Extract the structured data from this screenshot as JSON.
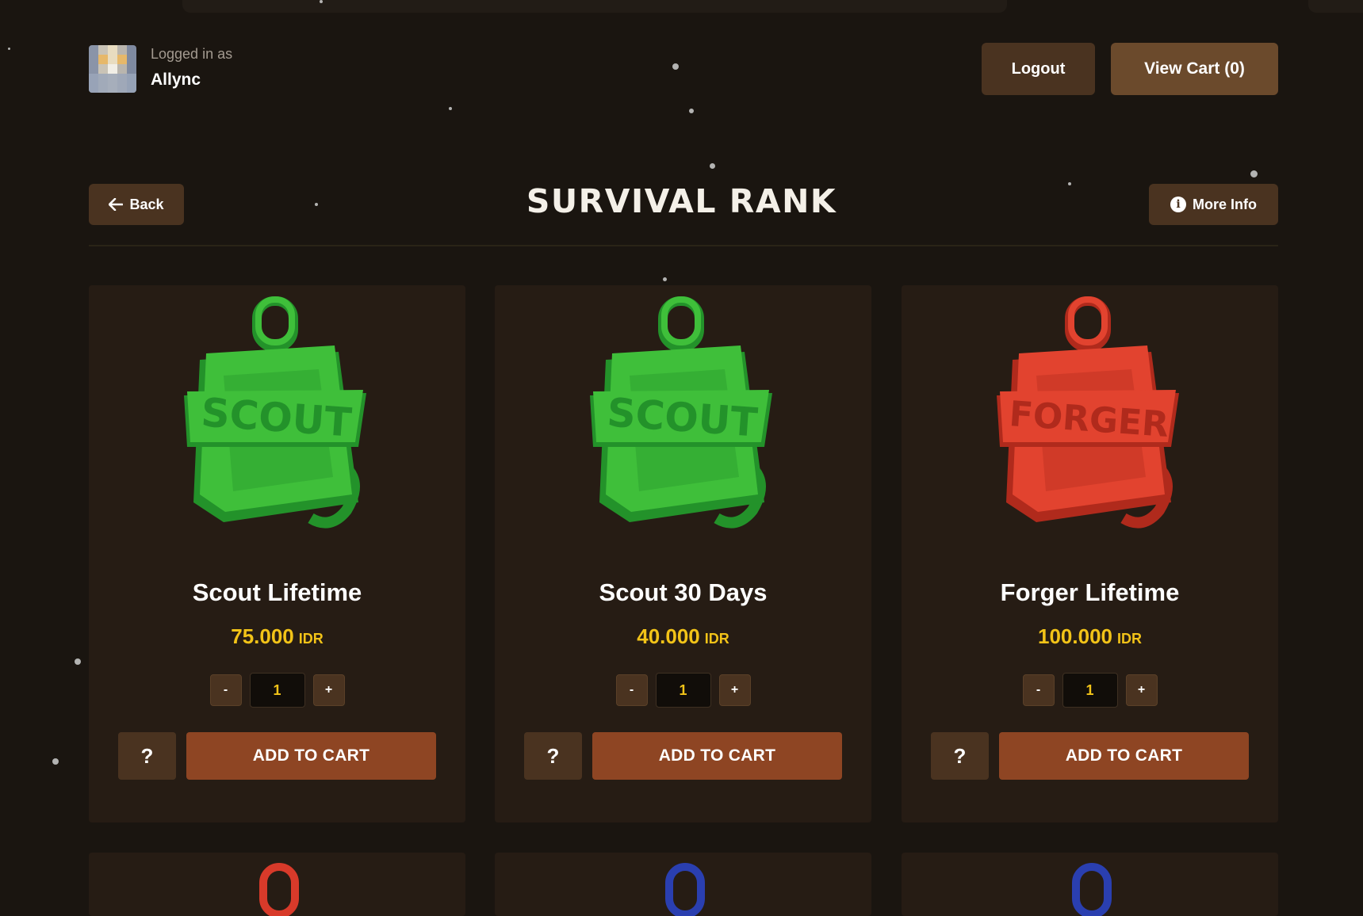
{
  "header": {
    "logged_in_label": "Logged in as",
    "username": "Allync",
    "logout_label": "Logout",
    "cart_label": "View Cart (0)"
  },
  "nav": {
    "back_label": "Back",
    "page_title": "SURVIVAL RANK",
    "more_info_label": "More Info"
  },
  "products": [
    {
      "name": "Scout Lifetime",
      "price": "75.000",
      "currency": "IDR",
      "quantity": "1",
      "badge_text": "SCOUT",
      "color": "#3fbf3a",
      "dark": "#23922a"
    },
    {
      "name": "Scout 30 Days",
      "price": "40.000",
      "currency": "IDR",
      "quantity": "1",
      "badge_text": "SCOUT",
      "color": "#3fbf3a",
      "dark": "#23922a"
    },
    {
      "name": "Forger Lifetime",
      "price": "100.000",
      "currency": "IDR",
      "quantity": "1",
      "badge_text": "FORGER",
      "color": "#e2432f",
      "dark": "#b02a1c"
    }
  ],
  "card_labels": {
    "minus": "-",
    "plus": "+",
    "help": "?",
    "add_to_cart": "ADD TO CART"
  },
  "next_row_colors": [
    "#d83a2a",
    "#2a3fb0",
    "#2a3fb0"
  ],
  "colors": {
    "background": "#1a1510",
    "card": "#261c14",
    "button_brown": "#4a3320",
    "accent_orange": "#8e4523",
    "price_yellow": "#f2c318"
  }
}
